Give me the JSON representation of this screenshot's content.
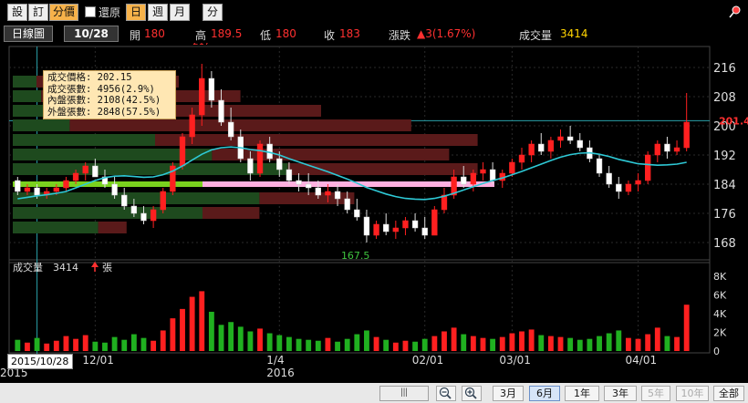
{
  "toolbar": {
    "buttons": [
      {
        "label": "設",
        "active": false
      },
      {
        "label": "訂",
        "active": false
      },
      {
        "label": "分價",
        "active": true
      }
    ],
    "restore_label": "還原",
    "period_buttons": [
      {
        "label": "日",
        "active": true
      },
      {
        "label": "週",
        "active": false
      },
      {
        "label": "月",
        "active": false
      }
    ],
    "minute_label": "分"
  },
  "info": {
    "period": "日線圖",
    "date": "10/28",
    "open_label": "開",
    "open": "180",
    "high_label": "高",
    "high": "189.5",
    "low_label": "低",
    "low": "180",
    "close_label": "收",
    "close": "183",
    "change_label": "漲跌",
    "change": "▲3(1.67%)",
    "volume_label": "成交量",
    "volume": "3414"
  },
  "tooltip": {
    "lines": [
      "成交價格: 202.15",
      "成交張數: 4956(2.9%)",
      "內盤張數: 2108(42.5%)",
      "外盤張數: 2848(57.5%)"
    ]
  },
  "price_axis": {
    "ticks": [
      "216",
      "208",
      "200",
      "192",
      "184",
      "176",
      "168"
    ],
    "current_price": "201.4",
    "low_marker": "167.5",
    "high_marker": "217"
  },
  "volume_panel": {
    "label": "成交量",
    "value": "3414",
    "trend": "張",
    "ticks": [
      "8K",
      "6K",
      "4K",
      "2K",
      "0"
    ]
  },
  "x_axis": {
    "labels": [
      "12/01",
      "1/4",
      "02/01",
      "03/01",
      "04/01"
    ],
    "year_labels": [
      "2015",
      "2016"
    ],
    "cursor_date": "2015/10/28"
  },
  "bottom": {
    "scroll_label": "|||",
    "zoom_out_icon": "zoom-out-icon",
    "zoom_in_icon": "zoom-in-icon",
    "ranges": [
      {
        "label": "3月",
        "selected": false,
        "enabled": true
      },
      {
        "label": "6月",
        "selected": true,
        "enabled": true
      },
      {
        "label": "1年",
        "selected": false,
        "enabled": true
      },
      {
        "label": "3年",
        "selected": false,
        "enabled": true
      },
      {
        "label": "5年",
        "selected": false,
        "enabled": false
      },
      {
        "label": "10年",
        "selected": false,
        "enabled": false
      },
      {
        "label": "全部",
        "selected": false,
        "enabled": true
      }
    ]
  },
  "colors": {
    "up": "#ff2020",
    "down": "#20b020",
    "ma": "#2ec9d6",
    "volume_profile_up": "#5a1a1a",
    "volume_profile_down": "#1e4a1e",
    "profile_highlight_green": "#7ad11e",
    "profile_highlight_pink": "#ffb0e0"
  },
  "chart_data": {
    "type": "candlestick",
    "title": "",
    "price_range": [
      164,
      220
    ],
    "volume_range": [
      0,
      8000
    ],
    "candles": [
      [
        185,
        186,
        181,
        182
      ],
      [
        182,
        184,
        181,
        183
      ],
      [
        183,
        184,
        180,
        181
      ],
      [
        181,
        183,
        180,
        182
      ],
      [
        182,
        184,
        181,
        183
      ],
      [
        183,
        186,
        182,
        185
      ],
      [
        185,
        188,
        184,
        187
      ],
      [
        187,
        190,
        185,
        189
      ],
      [
        189,
        191,
        186,
        186
      ],
      [
        186,
        188,
        183,
        184
      ],
      [
        184,
        186,
        180,
        181
      ],
      [
        181,
        183,
        177,
        178
      ],
      [
        178,
        180,
        175,
        176
      ],
      [
        176,
        178,
        173,
        174
      ],
      [
        174,
        178,
        172,
        177
      ],
      [
        177,
        183,
        176,
        182
      ],
      [
        182,
        190,
        181,
        189
      ],
      [
        189,
        198,
        188,
        197
      ],
      [
        197,
        205,
        195,
        203
      ],
      [
        203,
        217,
        200,
        213
      ],
      [
        213,
        215,
        205,
        207
      ],
      [
        207,
        210,
        200,
        201
      ],
      [
        201,
        205,
        196,
        197
      ],
      [
        197,
        199,
        190,
        191
      ],
      [
        191,
        193,
        185,
        187
      ],
      [
        187,
        196,
        186,
        195
      ],
      [
        195,
        197,
        190,
        191
      ],
      [
        191,
        193,
        186,
        188
      ],
      [
        188,
        190,
        184,
        185
      ],
      [
        185,
        187,
        182,
        184
      ],
      [
        184,
        187,
        181,
        183
      ],
      [
        183,
        185,
        180,
        181
      ],
      [
        181,
        184,
        179,
        182
      ],
      [
        182,
        184,
        178,
        180
      ],
      [
        180,
        182,
        176,
        177
      ],
      [
        177,
        180,
        174,
        175
      ],
      [
        175,
        177,
        168,
        170
      ],
      [
        170,
        174,
        169,
        173
      ],
      [
        173,
        176,
        170,
        171
      ],
      [
        171,
        174,
        169,
        172
      ],
      [
        172,
        175,
        170,
        174
      ],
      [
        174,
        176,
        171,
        172
      ],
      [
        172,
        175,
        169,
        170
      ],
      [
        170,
        178,
        170,
        177
      ],
      [
        177,
        183,
        176,
        181
      ],
      [
        181,
        188,
        180,
        186
      ],
      [
        186,
        189,
        183,
        184
      ],
      [
        184,
        188,
        182,
        187
      ],
      [
        187,
        190,
        185,
        188
      ],
      [
        188,
        190,
        184,
        185
      ],
      [
        185,
        188,
        183,
        187
      ],
      [
        187,
        191,
        186,
        190
      ],
      [
        190,
        194,
        188,
        192
      ],
      [
        192,
        196,
        190,
        195
      ],
      [
        195,
        198,
        192,
        193
      ],
      [
        193,
        197,
        191,
        196
      ],
      [
        196,
        199,
        194,
        197
      ],
      [
        197,
        200,
        195,
        196
      ],
      [
        196,
        198,
        193,
        194
      ],
      [
        194,
        196,
        190,
        191
      ],
      [
        191,
        192,
        186,
        187
      ],
      [
        187,
        189,
        183,
        184
      ],
      [
        184,
        186,
        180,
        182
      ],
      [
        182,
        185,
        181,
        184
      ],
      [
        184,
        187,
        182,
        185
      ],
      [
        185,
        193,
        184,
        192
      ],
      [
        192,
        196,
        190,
        195
      ],
      [
        195,
        197,
        191,
        193
      ],
      [
        193,
        196,
        192,
        194
      ],
      [
        194,
        209,
        193,
        201
      ]
    ],
    "volume": [
      1200,
      900,
      1400,
      800,
      1100,
      1600,
      1300,
      1700,
      1000,
      900,
      1500,
      1200,
      1800,
      1400,
      1100,
      2200,
      3500,
      4500,
      5800,
      6400,
      4200,
      2800,
      3100,
      2600,
      2100,
      2400,
      1900,
      1700,
      1500,
      1300,
      1200,
      1100,
      1400,
      1000,
      1300,
      1800,
      2200,
      1500,
      1200,
      900,
      1100,
      1000,
      1300,
      1600,
      2100,
      2500,
      1800,
      1600,
      1400,
      1300,
      1500,
      1900,
      2100,
      2300,
      1700,
      1600,
      1500,
      1400,
      1200,
      1300,
      1600,
      1900,
      2200,
      1400,
      1300,
      1800,
      2500,
      1600,
      1500,
      4956
    ],
    "moving_average": [
      180,
      180.4,
      180.8,
      181.1,
      181.5,
      182,
      183,
      184,
      185,
      185.8,
      186.2,
      186.3,
      186.1,
      185.9,
      186,
      186.6,
      187.6,
      189,
      190.6,
      192.2,
      193.4,
      194,
      194.2,
      194,
      193.5,
      193.2,
      192.7,
      192,
      191,
      190.1,
      189.2,
      188.3,
      187.4,
      186.4,
      185.4,
      184.3,
      183.1,
      182.2,
      181.3,
      180.6,
      180.1,
      179.9,
      179.8,
      180.1,
      180.7,
      181.5,
      182.4,
      183.3,
      184.2,
      185,
      185.7,
      186.6,
      187.5,
      188.5,
      189.5,
      190.5,
      191.4,
      192.1,
      192.5,
      192.6,
      192.2,
      191.6,
      190.8,
      190.2,
      189.6,
      189.4,
      189.2,
      189.3,
      189.5,
      190
    ],
    "volume_profile": [
      {
        "price": 212,
        "up": 0.3,
        "down": 0.05
      },
      {
        "price": 208,
        "up": 0.42,
        "down": 0.06
      },
      {
        "price": 204,
        "up": 0.55,
        "down": 0.1
      },
      {
        "price": 200,
        "up": 0.72,
        "down": 0.12
      },
      {
        "price": 196,
        "up": 0.68,
        "down": 0.3
      },
      {
        "price": 192,
        "up": 0.5,
        "down": 0.42
      },
      {
        "price": 188,
        "up": 0.4,
        "down": 0.58
      },
      {
        "price": 184,
        "up": 0.35,
        "down": 0.8,
        "highlight": true
      },
      {
        "price": 180,
        "up": 0.2,
        "down": 0.52
      },
      {
        "price": 176,
        "up": 0.12,
        "down": 0.4
      },
      {
        "price": 172,
        "up": 0.06,
        "down": 0.18
      }
    ]
  }
}
